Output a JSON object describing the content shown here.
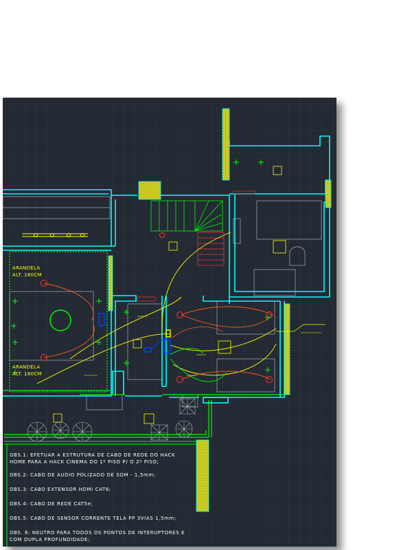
{
  "labels": {
    "arandela_top_1": "ARANDELA",
    "arandela_top_2": "ALT. 180CM",
    "arandela_bottom_1": "ARANDELA",
    "arandela_bottom_2": "ALT. 180CM"
  },
  "notes": {
    "obs1_line1": "OBS.1: EFETUAR A ESTRUTURA DE CABO DE REDE DO HACK",
    "obs1_line2": "HOME PARA A HACK CINEMA DO 1º PISO P/ O 2º PISO;",
    "obs2": "OBS.2: CABO DE AUDIO POLIZADO DE SOM - 1,5mm;",
    "obs3": "OBS.3: CABO EXTENSOR HDMI CAT6;",
    "obs4": "OBS.4: CABO DE REDE CAT5e;",
    "obs5": "OBS.5: CABO DE SENSOR CORRENTE TELA PP 3VIAS 1,5mm;",
    "obs6_line1": "OBS. 6: NEUTRO PARA TODOS OS PONTOS DE INTERUPTORES E",
    "obs6_line2": "COM DUPLA PROFUNDIDADE;"
  },
  "colors": {
    "background": "#232a33",
    "walls": "#00ffff",
    "stairs": "#00ff00",
    "lights": "#ff3030",
    "wiring_yellow": "#ffff00",
    "wiring_orange": "#ff5a1e",
    "wiring_green": "#00ff00",
    "symbols_blue": "#0044ff",
    "furniture": "#9aa0a8"
  }
}
